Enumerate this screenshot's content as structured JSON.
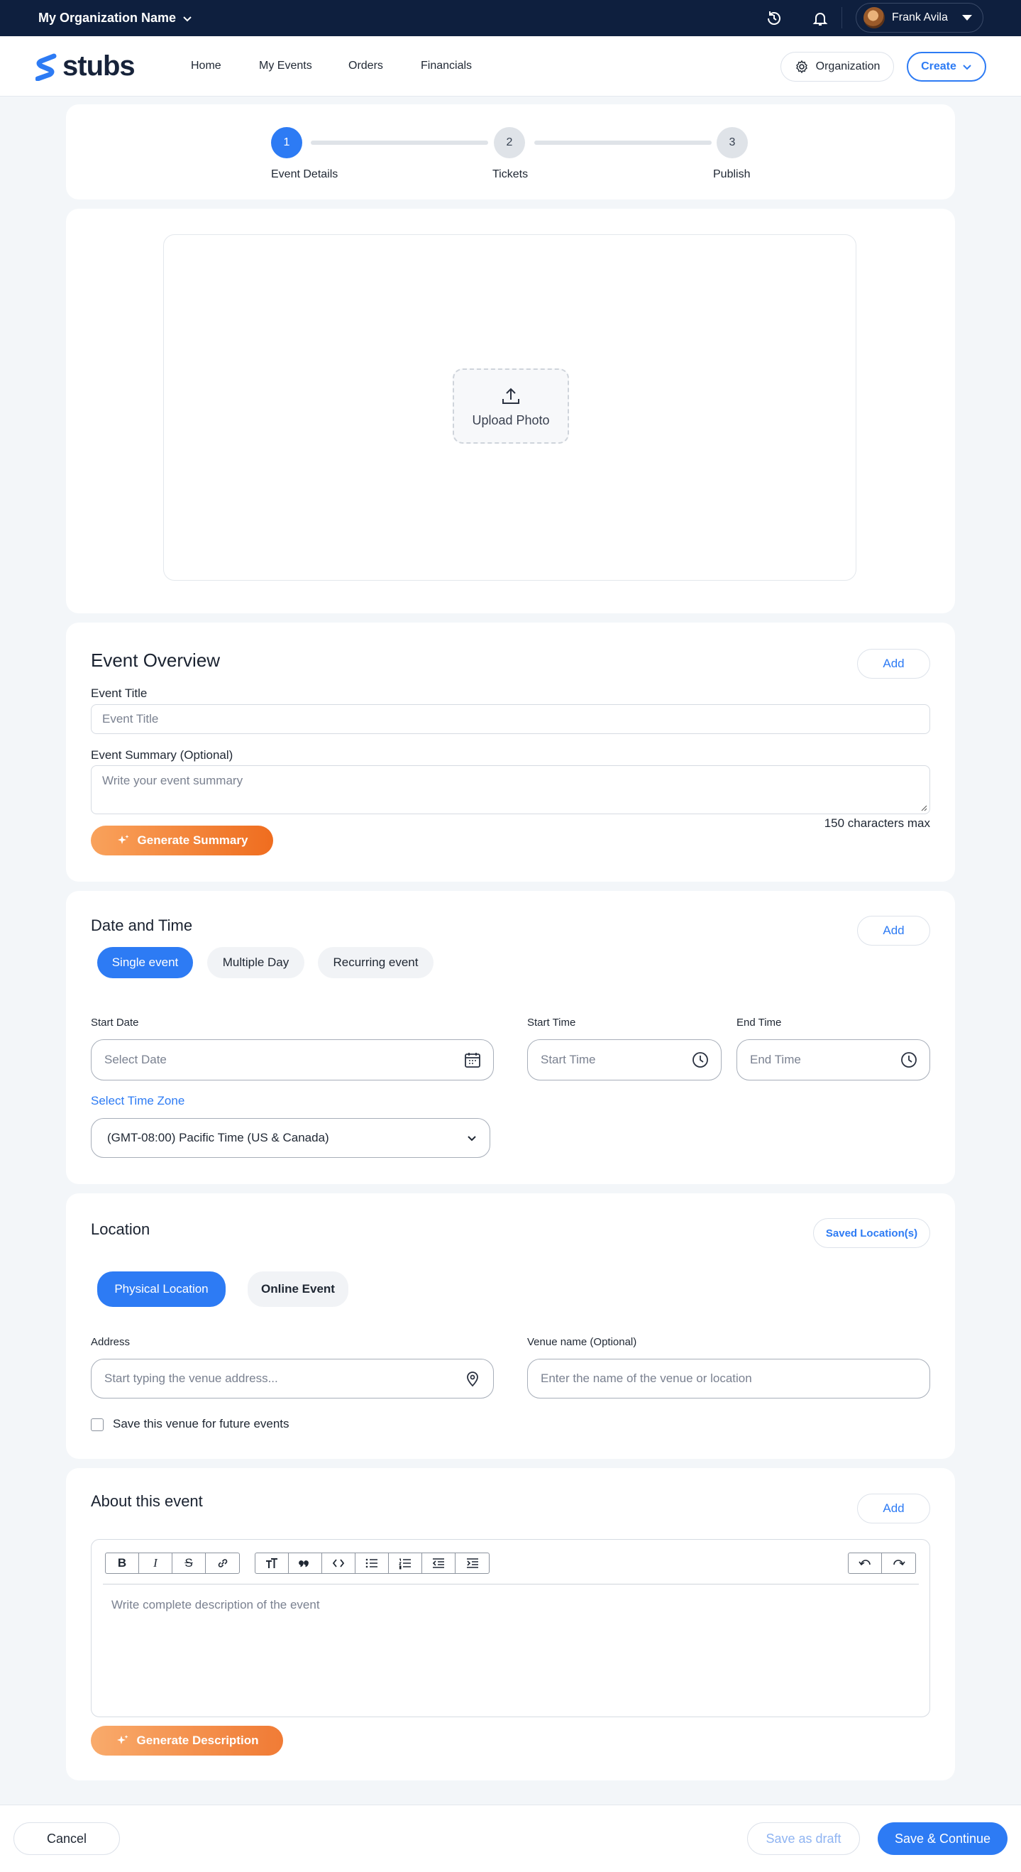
{
  "topbar": {
    "org_name": "My Organization Name",
    "user_name": "Frank Avila"
  },
  "nav": {
    "logo_text": "stubs",
    "links": [
      "Home",
      "My Events",
      "Orders",
      "Financials"
    ],
    "organization_label": "Organization",
    "create_label": "Create"
  },
  "stepper": {
    "steps": [
      {
        "number": "1",
        "label": "Event Details",
        "active": true
      },
      {
        "number": "2",
        "label": "Tickets",
        "active": false
      },
      {
        "number": "3",
        "label": "Publish",
        "active": false
      }
    ]
  },
  "upload": {
    "label": "Upload Photo"
  },
  "overview": {
    "title": "Event Overview",
    "add_label": "Add",
    "event_title_label": "Event Title",
    "event_title_placeholder": "Event Title",
    "summary_label": "Event Summary (Optional)",
    "summary_placeholder": "Write your event summary",
    "char_limit": "150 characters max",
    "generate_label": "Generate Summary"
  },
  "datetime": {
    "title": "Date and Time",
    "add_label": "Add",
    "tabs": [
      "Single event",
      "Multiple Day",
      "Recurring event"
    ],
    "active_tab": "Single event",
    "start_date_label": "Start Date",
    "start_date_placeholder": "Select Date",
    "start_time_label": "Start Time",
    "start_time_placeholder": "Start Time",
    "end_time_label": "End Time",
    "end_time_placeholder": "End Time",
    "timezone_label": "Select Time Zone",
    "timezone_value": "(GMT-08:00) Pacific Time (US & Canada)"
  },
  "location": {
    "title": "Location",
    "saved_label": "Saved Location(s)",
    "tabs": [
      "Physical Location",
      "Online Event"
    ],
    "active_tab": "Physical Location",
    "address_label": "Address",
    "address_placeholder": "Start typing the venue address...",
    "venue_label": "Venue name (Optional)",
    "venue_placeholder": "Enter the name of the venue or location",
    "save_venue_label": "Save this venue for future events"
  },
  "about": {
    "title": "About this event",
    "add_label": "Add",
    "editor_placeholder": "Write complete description of the event",
    "generate_label": "Generate Description"
  },
  "footer": {
    "cancel_label": "Cancel",
    "draft_label": "Save as draft",
    "continue_label": "Save & Continue"
  },
  "colors": {
    "primary": "#2d7bf4",
    "topbar": "#0e1f3e",
    "accent_orange": "#ef6d1f"
  }
}
